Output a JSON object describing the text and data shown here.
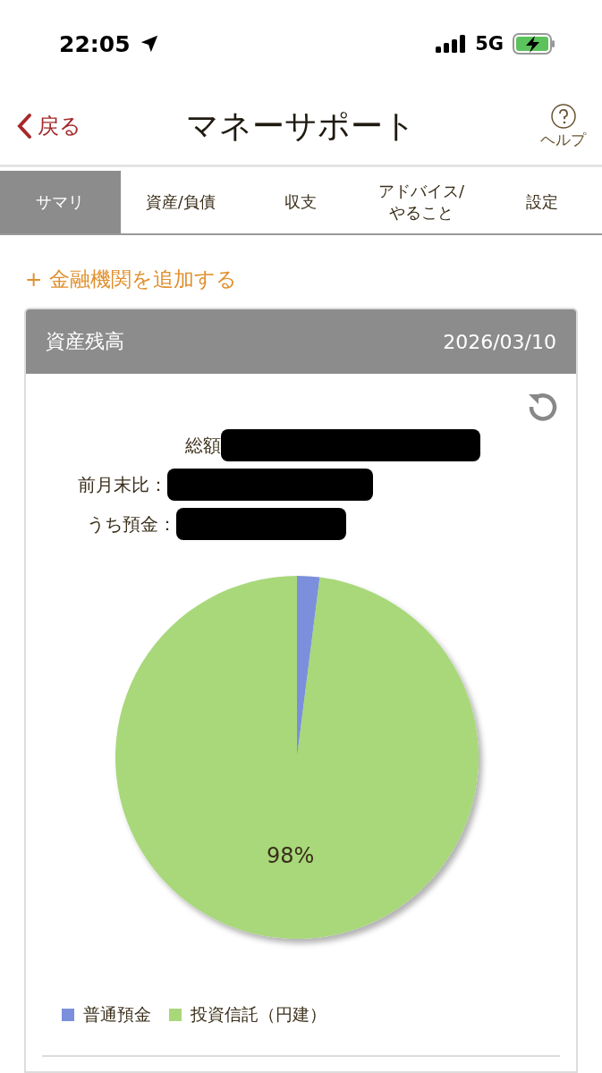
{
  "status_bar": {
    "time": "22:05",
    "network": "5G"
  },
  "header": {
    "back": "戻る",
    "title": "マネーサポート",
    "help": "ヘルプ"
  },
  "tabs": [
    {
      "label": "サマリ",
      "selected": true
    },
    {
      "label": "資産/負債",
      "selected": false
    },
    {
      "label": "収支",
      "selected": false
    },
    {
      "label": "アドバイス/\nやること",
      "selected": false
    },
    {
      "label": "設定",
      "selected": false
    }
  ],
  "add_link": "+ 金融機関を追加する",
  "card": {
    "title": "資産残高",
    "date": "2026/03/10",
    "summary": [
      "総額",
      "前月末比：",
      "うち預金："
    ],
    "chart_data": {
      "type": "pie",
      "categories": [
        "普通預金",
        "投資信託（円建）"
      ],
      "values": [
        2,
        98
      ],
      "colors": [
        "#7b8fdc",
        "#a8d87a"
      ],
      "value_labels": [
        null,
        "98%"
      ]
    }
  }
}
